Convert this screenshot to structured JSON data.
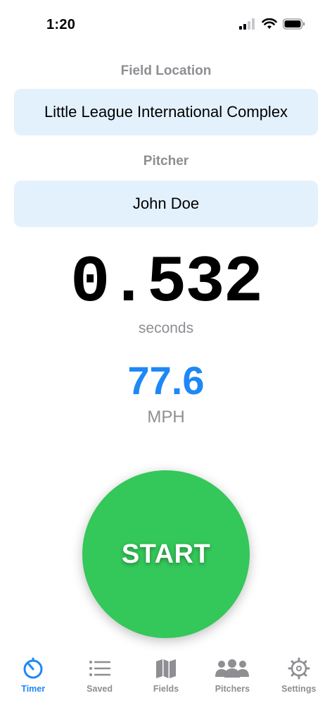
{
  "status": {
    "time": "1:20"
  },
  "field_location": {
    "label": "Field Location",
    "value": "Little League International Complex"
  },
  "pitcher": {
    "label": "Pitcher",
    "value": "John Doe"
  },
  "timer": {
    "seconds": "0.532",
    "seconds_unit": "seconds",
    "mph": "77.6",
    "mph_unit": "MPH"
  },
  "start_button": {
    "label": "START"
  },
  "tabs": [
    {
      "label": "Timer",
      "icon": "stopwatch-icon",
      "active": true
    },
    {
      "label": "Saved",
      "icon": "list-icon",
      "active": false
    },
    {
      "label": "Fields",
      "icon": "map-icon",
      "active": false
    },
    {
      "label": "Pitchers",
      "icon": "people-icon",
      "active": false
    },
    {
      "label": "Settings",
      "icon": "gear-icon",
      "active": false
    }
  ],
  "colors": {
    "accent": "#1e88f5",
    "start": "#34c759",
    "field_bg": "#e3f1fd",
    "muted": "#8e8e93"
  }
}
